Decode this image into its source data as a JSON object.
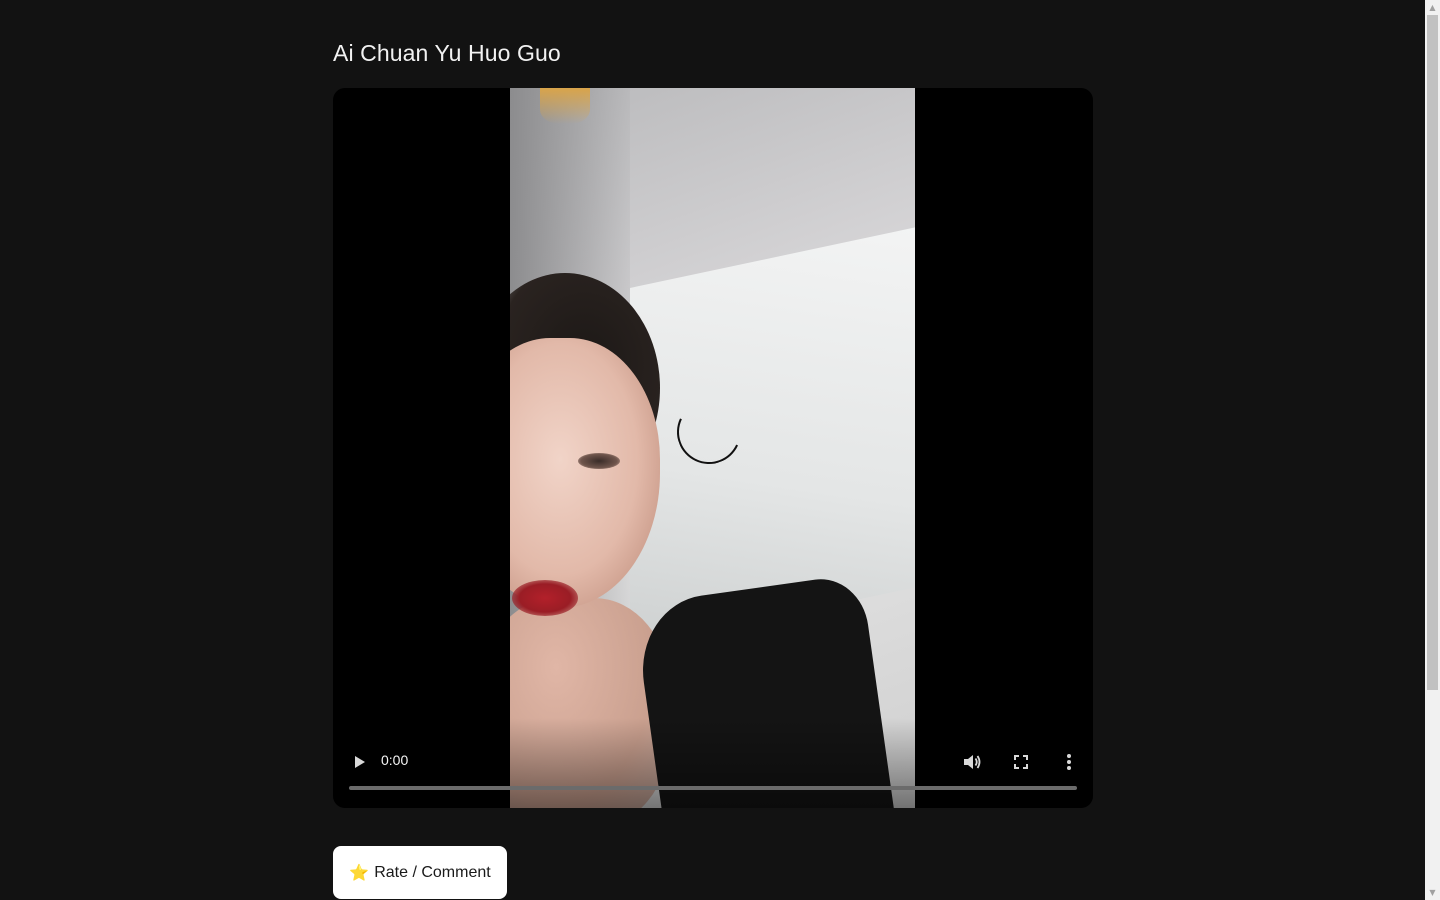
{
  "page": {
    "title": "Ai Chuan Yu Huo Guo"
  },
  "video": {
    "current_time": "0:00",
    "progress": 0,
    "state": "loading",
    "icons": {
      "play": "play-icon",
      "volume": "volume-icon",
      "fullscreen": "fullscreen-icon",
      "more": "more-vert-icon",
      "spinner": "loading-spinner-icon"
    }
  },
  "actions": {
    "rate_star": "⭐",
    "rate_label": "Rate / Comment"
  },
  "colors": {
    "background": "#121212",
    "button_bg": "#ffffff",
    "title_text": "#f2f2f2"
  }
}
